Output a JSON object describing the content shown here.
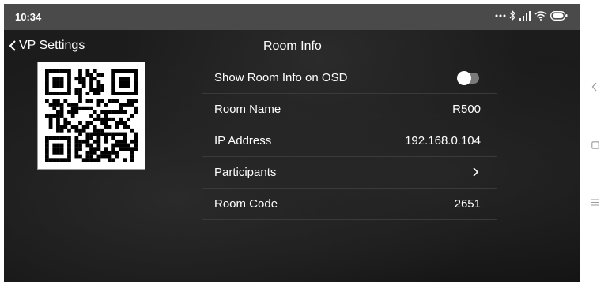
{
  "status_bar": {
    "time": "10:34",
    "icons": [
      "more-dots-icon",
      "bluetooth-icon",
      "signal-icon",
      "wifi-icon",
      "battery-icon"
    ]
  },
  "nav": {
    "back_label": "VP Settings",
    "title": "Room Info"
  },
  "qr_code": {
    "icon": "qr-code"
  },
  "settings": {
    "show_osd": {
      "label": "Show Room Info on OSD",
      "enabled": false
    },
    "room_name": {
      "label": "Room Name",
      "value": "R500"
    },
    "ip_address": {
      "label": "IP Address",
      "value": "192.168.0.104"
    },
    "participants": {
      "label": "Participants"
    },
    "room_code": {
      "label": "Room Code",
      "value": "2651"
    }
  },
  "system_nav": {
    "buttons": [
      "back-icon",
      "home-icon",
      "menu-icon"
    ]
  },
  "colors": {
    "status_bar": "#4a4a4a",
    "background": "#1a1a1a",
    "text": "#ffffff",
    "toggle_off": "#7a7a7a"
  }
}
